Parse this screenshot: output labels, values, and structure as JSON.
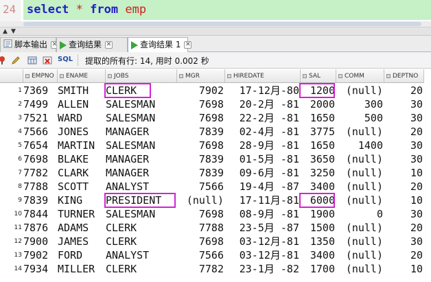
{
  "editor": {
    "line_number": "24",
    "keyword_select": "select",
    "operator": "*",
    "keyword_from": "from",
    "table_name": "emp"
  },
  "tabs": [
    {
      "label": "脚本输出",
      "icon": "script-output-icon",
      "close": "✕"
    },
    {
      "label": "查询结果",
      "icon": "query-result-icon",
      "close": "✕"
    },
    {
      "label": "查询结果 1",
      "icon": "query-result-icon",
      "close": "✕"
    }
  ],
  "toolbar": {
    "sql_label": "SQL",
    "status": "提取的所有行: 14, 用时 0.002 秒",
    "icons": [
      "pin-icon",
      "edit-icon",
      "export-icon",
      "delete-icon"
    ]
  },
  "table": {
    "columns": [
      "EMPNO",
      "ENAME",
      "JOBS",
      "MGR",
      "HIREDATE",
      "SAL",
      "COMM",
      "DEPTNO"
    ],
    "rows": [
      {
        "num": "1",
        "cells": [
          "7369",
          "SMITH",
          "CLERK",
          "7902",
          "17-12月-80",
          "1200",
          "(null)",
          "20"
        ]
      },
      {
        "num": "2",
        "cells": [
          "7499",
          "ALLEN",
          "SALESMAN",
          "7698",
          "20-2月 -81",
          "2000",
          "300",
          "30"
        ]
      },
      {
        "num": "3",
        "cells": [
          "7521",
          "WARD",
          "SALESMAN",
          "7698",
          "22-2月 -81",
          "1650",
          "500",
          "30"
        ]
      },
      {
        "num": "4",
        "cells": [
          "7566",
          "JONES",
          "MANAGER",
          "7839",
          "02-4月 -81",
          "3775",
          "(null)",
          "20"
        ]
      },
      {
        "num": "5",
        "cells": [
          "7654",
          "MARTIN",
          "SALESMAN",
          "7698",
          "28-9月 -81",
          "1650",
          "1400",
          "30"
        ]
      },
      {
        "num": "6",
        "cells": [
          "7698",
          "BLAKE",
          "MANAGER",
          "7839",
          "01-5月 -81",
          "3650",
          "(null)",
          "30"
        ]
      },
      {
        "num": "7",
        "cells": [
          "7782",
          "CLARK",
          "MANAGER",
          "7839",
          "09-6月 -81",
          "3250",
          "(null)",
          "10"
        ]
      },
      {
        "num": "8",
        "cells": [
          "7788",
          "SCOTT",
          "ANALYST",
          "7566",
          "19-4月 -87",
          "3400",
          "(null)",
          "20"
        ]
      },
      {
        "num": "9",
        "cells": [
          "7839",
          "KING",
          "PRESIDENT",
          "(null)",
          "17-11月-81",
          "6000",
          "(null)",
          "10"
        ]
      },
      {
        "num": "10",
        "cells": [
          "7844",
          "TURNER",
          "SALESMAN",
          "7698",
          "08-9月 -81",
          "1900",
          "0",
          "30"
        ]
      },
      {
        "num": "11",
        "cells": [
          "7876",
          "ADAMS",
          "CLERK",
          "7788",
          "23-5月 -87",
          "1500",
          "(null)",
          "20"
        ]
      },
      {
        "num": "12",
        "cells": [
          "7900",
          "JAMES",
          "CLERK",
          "7698",
          "03-12月-81",
          "1350",
          "(null)",
          "30"
        ]
      },
      {
        "num": "13",
        "cells": [
          "7902",
          "FORD",
          "ANALYST",
          "7566",
          "03-12月-81",
          "3400",
          "(null)",
          "20"
        ]
      },
      {
        "num": "14",
        "cells": [
          "7934",
          "MILLER",
          "CLERK",
          "7782",
          "23-1月 -82",
          "1700",
          "(null)",
          "10"
        ]
      }
    ],
    "highlighted": [
      {
        "row": 1,
        "column": "JOBS"
      },
      {
        "row": 1,
        "column": "SAL"
      },
      {
        "row": 9,
        "column": "JOBS"
      },
      {
        "row": 9,
        "column": "SAL"
      }
    ],
    "highlight_color": "#d321d3"
  },
  "colors": {
    "keyword": "#1f1fc8",
    "identifier": "#cc2020",
    "current_line": "#c6f0c6"
  }
}
